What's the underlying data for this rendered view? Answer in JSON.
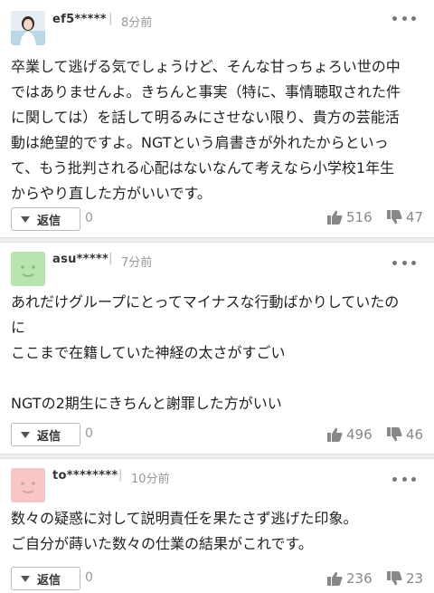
{
  "comments": [
    {
      "user": "ef5*****",
      "time": "8分前",
      "avatar": "photo-avatar",
      "lines": [
        "卒業して逃げる気でしょうけど、そんな甘っちょろい世の中",
        "ではありませんよ。きちんと事実（特に、事情聴取された件",
        "に関しては）を話して明るみにさせない限り、貴方の芸能活",
        "動は絶望的ですよ。NGTという肩書きが外れたからといっ",
        "て、もう批判される心配はないなんて考えなら小学校1年生",
        "からやり直した方がいいです。"
      ],
      "reply_label": "返信",
      "reply_count": "0",
      "likes": "516",
      "dislikes": "47"
    },
    {
      "user": "asu*****",
      "time": "7分前",
      "avatar": "green-smiley-avatar",
      "lines": [
        "あれだけグループにとってマイナスな行動ばかりしていたの",
        "に",
        "ここまで在籍していた神経の太さがすごい",
        "",
        "NGTの2期生にきちんと謝罪した方がいい"
      ],
      "reply_label": "返信",
      "reply_count": "0",
      "likes": "496",
      "dislikes": "46"
    },
    {
      "user": "to********",
      "time": "10分前",
      "avatar": "pink-smiley-avatar",
      "lines": [
        "数々の疑惑に対して説明責任を果たさず逃げた印象。",
        "ご自分が蒔いた数々の仕業の結果がこれです。"
      ],
      "reply_label": "返信",
      "reply_count": "0",
      "likes": "236",
      "dislikes": "23"
    }
  ],
  "colors": {
    "green_avatar": "#b9e4b0",
    "pink_avatar": "#f7c6c6",
    "divider": "#eeeeee"
  }
}
